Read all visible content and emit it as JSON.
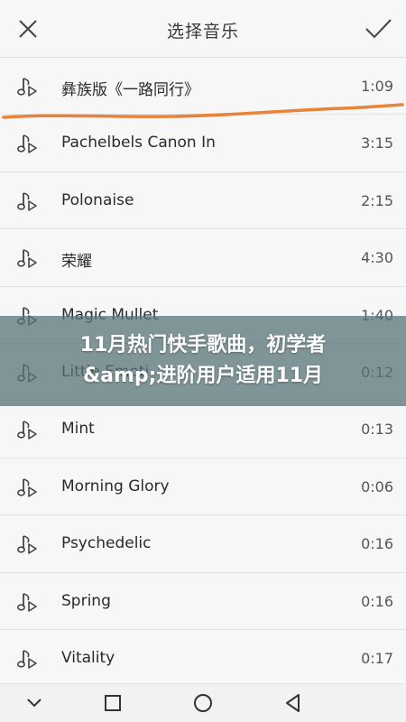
{
  "header": {
    "title": "选择音乐",
    "close_icon": "close-icon",
    "confirm_icon": "check-icon"
  },
  "songs": [
    {
      "name": "彝族版《一路同行》",
      "duration": "1:09"
    },
    {
      "name": "Pachelbels Canon In",
      "duration": "3:15"
    },
    {
      "name": "Polonaise",
      "duration": "2:15"
    },
    {
      "name": "荣耀",
      "duration": "4:30"
    },
    {
      "name": "Magic Mullet",
      "duration": "1:40"
    },
    {
      "name": "Little Emoti",
      "duration": "0:12"
    },
    {
      "name": "Mint",
      "duration": "0:13"
    },
    {
      "name": "Morning Glory",
      "duration": "0:06"
    },
    {
      "name": "Psychedelic",
      "duration": "0:16"
    },
    {
      "name": "Spring",
      "duration": "0:16"
    },
    {
      "name": "Vitality",
      "duration": "0:17"
    }
  ],
  "banner": {
    "line1": "11月热门快手歌曲，初学者",
    "line2": "&amp;进阶用户适用11月"
  },
  "colors": {
    "highlight_underline": "#e8843a",
    "banner_overlay": "#587478"
  },
  "navbar": {
    "back_icon": "chevron-down-icon",
    "recents_icon": "square-icon",
    "home_icon": "circle-icon",
    "triangle_icon": "back-triangle-icon"
  }
}
